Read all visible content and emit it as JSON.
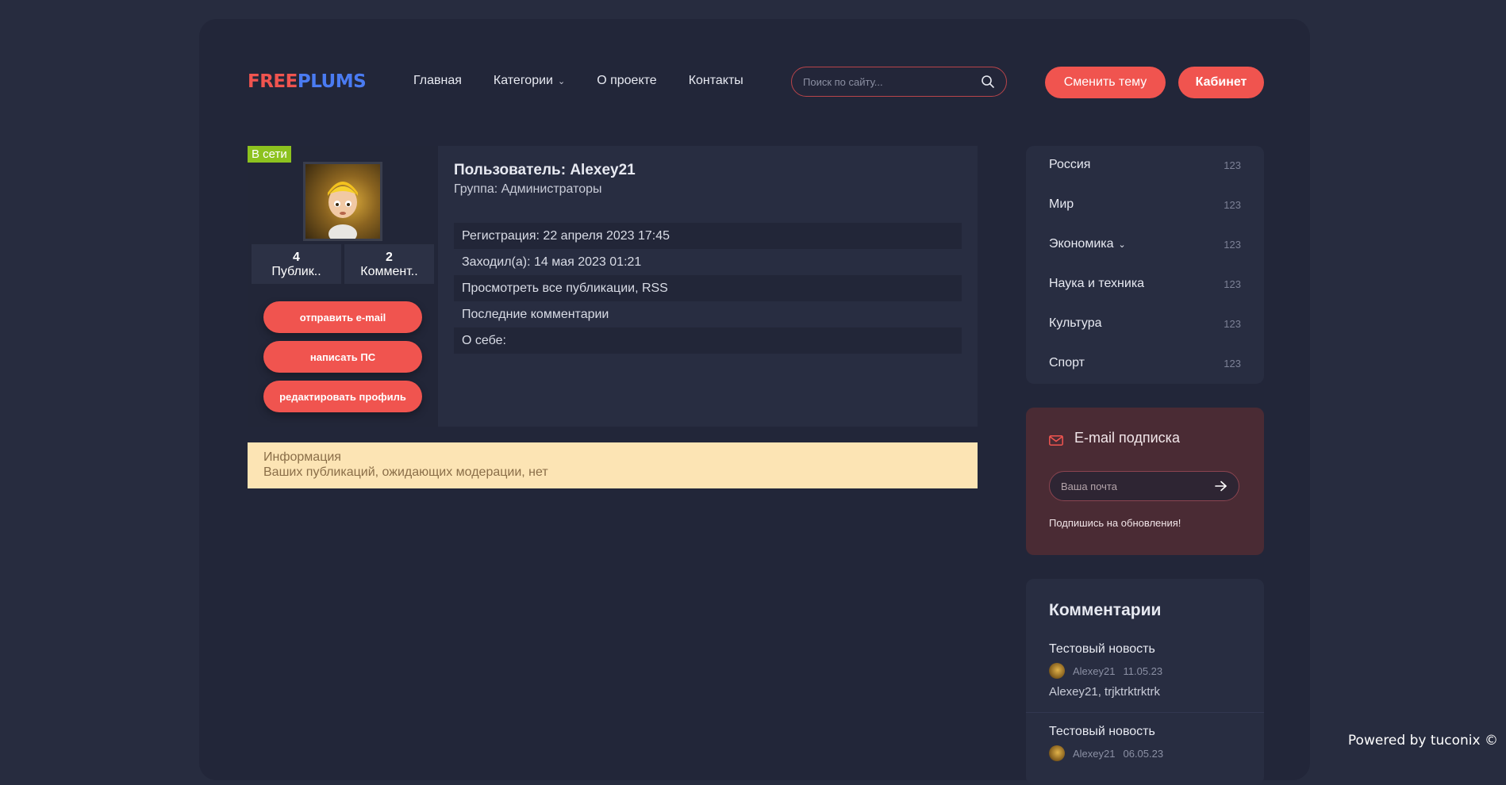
{
  "header": {
    "logo_part1": "FREE",
    "logo_part2": "PLUMS",
    "nav": [
      {
        "label": "Главная"
      },
      {
        "label": "Категории",
        "has_dropdown": true
      },
      {
        "label": "О проекте"
      },
      {
        "label": "Контакты"
      }
    ],
    "search_placeholder": "Поиск по сайту...",
    "theme_button": "Сменить тему",
    "cabinet_button": "Кабинет"
  },
  "profile": {
    "status": "В сети",
    "stats": [
      {
        "number": "4",
        "label": "Публик.."
      },
      {
        "number": "2",
        "label": "Коммент.."
      }
    ],
    "buttons": [
      "отправить e-mail",
      "написать ПС",
      "редактировать профиль"
    ],
    "title": "Пользователь: Alexey21",
    "group": "Группа: Администраторы",
    "rows": [
      "Регистрация: 22 апреля 2023 17:45",
      "Заходил(а): 14 мая 2023 01:21",
      "Просмотреть все публикации, RSS",
      "Последние комментарии",
      "О себе:"
    ]
  },
  "info": {
    "title": "Информация",
    "text": "Ваших публикаций, ожидающих модерации, нет"
  },
  "categories": [
    {
      "name": "Россия",
      "count": "123"
    },
    {
      "name": "Мир",
      "count": "123"
    },
    {
      "name": "Экономика",
      "count": "123",
      "has_dropdown": true
    },
    {
      "name": "Наука и техника",
      "count": "123"
    },
    {
      "name": "Культура",
      "count": "123"
    },
    {
      "name": "Спорт",
      "count": "123"
    }
  ],
  "subscription": {
    "title": "E-mail подписка",
    "placeholder": "Ваша почта",
    "note": "Подпишись на обновления!"
  },
  "comments": {
    "title": "Комментарии",
    "items": [
      {
        "title": "Тестовый новость",
        "author": "Alexey21",
        "date": "11.05.23",
        "text": "Alexey21, trjktrktrktrk"
      },
      {
        "title": "Тестовый новость",
        "author": "Alexey21",
        "date": "06.05.23",
        "text": ""
      }
    ]
  },
  "footer": {
    "powered": "Powered by tuconix ©"
  },
  "colors": {
    "accent": "#f0544f",
    "logo_blue": "#4a7bf2",
    "online": "#8dc21f",
    "info_bg": "#fce4b4"
  }
}
